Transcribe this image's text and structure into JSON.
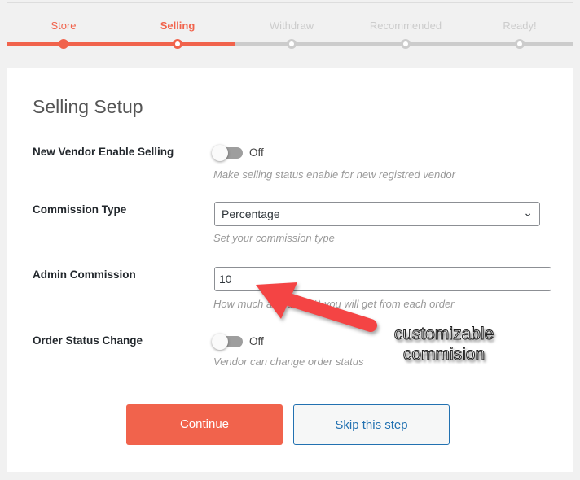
{
  "steps": [
    {
      "label": "Store",
      "state": "done"
    },
    {
      "label": "Selling",
      "state": "active"
    },
    {
      "label": "Withdraw",
      "state": "todo"
    },
    {
      "label": "Recommended",
      "state": "todo"
    },
    {
      "label": "Ready!",
      "state": "todo"
    }
  ],
  "colors": {
    "accent": "#f1634c",
    "inactive": "#cccccc",
    "link": "#2271b1"
  },
  "title": "Selling Setup",
  "fields": {
    "enable_selling": {
      "label": "New Vendor Enable Selling",
      "state": "Off",
      "help": "Make selling status enable for new registred vendor"
    },
    "commission_type": {
      "label": "Commission Type",
      "value": "Percentage",
      "help": "Set your commission type"
    },
    "admin_commission": {
      "label": "Admin Commission",
      "value": "10",
      "help": "How much amount (%) you will get from each order"
    },
    "order_status": {
      "label": "Order Status Change",
      "state": "Off",
      "help": "Vendor can change order status"
    }
  },
  "buttons": {
    "continue": "Continue",
    "skip": "Skip this step"
  },
  "annotation": {
    "line1": "customizable",
    "line2": "commision"
  }
}
